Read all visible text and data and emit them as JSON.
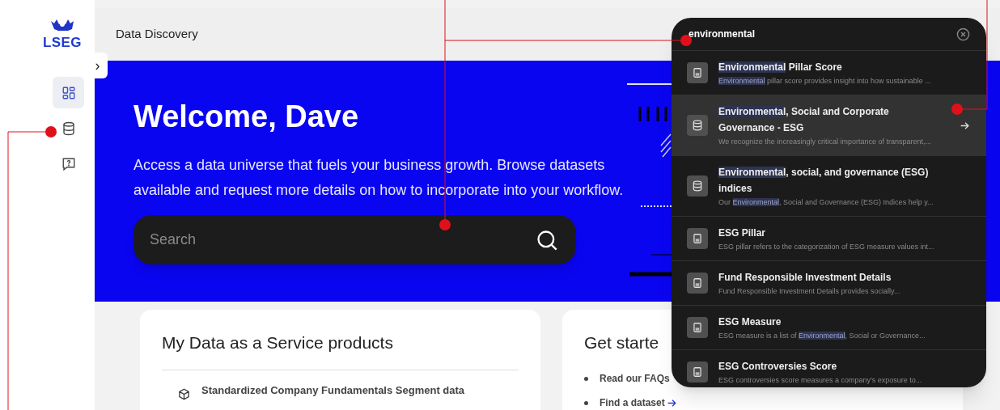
{
  "sidebar": {
    "logo_text": "LSEG",
    "expand_button": "›",
    "items": [
      {
        "kind": "grid",
        "selected": true
      },
      {
        "kind": "database",
        "selected": false
      },
      {
        "kind": "help",
        "selected": false
      }
    ]
  },
  "header": {
    "title": "Data Discovery"
  },
  "hero": {
    "heading": "Welcome, Dave",
    "text": "Access a data universe that fuels your business growth. Browse datasets available and request more details on how to incorporate into your workflow.",
    "search": {
      "placeholder": "Search"
    }
  },
  "cards": [
    {
      "title": "My Data as a Service products",
      "items": [
        "Standardized Company Fundamentals Segment data"
      ]
    },
    {
      "title": "Get starte",
      "links": [
        "Read our FAQs",
        "Find a dataset"
      ]
    }
  ],
  "search_popup": {
    "query": "environmental",
    "results": [
      {
        "kind": "book",
        "selected": false,
        "title": [
          {
            "text": "Environmental",
            "highlighted": true
          },
          {
            "text": " Pillar Score",
            "highlighted": false
          }
        ],
        "description": [
          {
            "text": "Environmental",
            "highlighted": true
          },
          {
            "text": " pillar score provides insight into how sustainable ...",
            "highlighted": false
          }
        ]
      },
      {
        "kind": "database",
        "selected": true,
        "title": [
          {
            "text": "Environmental",
            "highlighted": true
          },
          {
            "text": ", Social and Corporate Governance - ESG",
            "highlighted": false
          }
        ],
        "description": [
          {
            "text": "We recognize the increasingly critical importance of transparent,...",
            "highlighted": false
          }
        ]
      },
      {
        "kind": "database",
        "selected": false,
        "title": [
          {
            "text": "Environmental",
            "highlighted": true
          },
          {
            "text": ", social, and governance (ESG) indices",
            "highlighted": false
          }
        ],
        "description": [
          {
            "text": "Our ",
            "highlighted": false
          },
          {
            "text": "Environmental",
            "highlighted": true
          },
          {
            "text": ", Social and Governance (ESG) Indices help y...",
            "highlighted": false
          }
        ]
      },
      {
        "kind": "book",
        "selected": false,
        "title": [
          {
            "text": "ESG Pillar",
            "highlighted": false
          }
        ],
        "description": [
          {
            "text": "ESG pillar refers to the categorization of ESG measure values int...",
            "highlighted": false
          }
        ]
      },
      {
        "kind": "book",
        "selected": false,
        "title": [
          {
            "text": "Fund Responsible Investment Details",
            "highlighted": false
          }
        ],
        "description": [
          {
            "text": "Fund Responsible Investment Details provides socially...",
            "highlighted": false
          }
        ]
      },
      {
        "kind": "book",
        "selected": false,
        "title": [
          {
            "text": "ESG Measure",
            "highlighted": false
          }
        ],
        "description": [
          {
            "text": "ESG measure is a list of ",
            "highlighted": false
          },
          {
            "text": "Environmental",
            "highlighted": true
          },
          {
            "text": ", Social or Governance...",
            "highlighted": false
          }
        ]
      },
      {
        "kind": "book",
        "selected": false,
        "title": [
          {
            "text": "ESG Controversies Score",
            "highlighted": false
          }
        ],
        "description": [
          {
            "text": "ESG controversies score measures a company's exposure to...",
            "highlighted": false
          }
        ]
      }
    ]
  }
}
